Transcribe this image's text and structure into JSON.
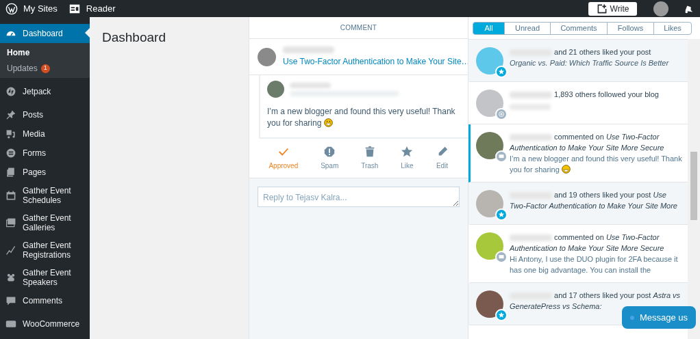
{
  "topbar": {
    "items": [
      {
        "kind": "wp",
        "label": "My Sites"
      },
      {
        "kind": "reader",
        "label": "Reader"
      }
    ],
    "write_button": "Write"
  },
  "sidebar": {
    "items": [
      {
        "label": "Dashboard",
        "selected": true,
        "children": [
          {
            "label": "Home",
            "selected": true
          },
          {
            "label": "Updates",
            "selected": false,
            "badge": "1"
          }
        ]
      },
      {
        "label": "Jetpack",
        "selected": false
      },
      {
        "label": "Posts",
        "selected": false
      },
      {
        "label": "Media",
        "selected": false
      },
      {
        "label": "Forms",
        "selected": false
      },
      {
        "label": "Pages",
        "selected": false
      },
      {
        "label": "Gather Event Schedules",
        "selected": false
      },
      {
        "label": "Gather Event Galleries",
        "selected": false
      },
      {
        "label": "Gather Event Registrations",
        "selected": false
      },
      {
        "label": "Gather Event Speakers",
        "selected": false
      },
      {
        "label": "Comments",
        "selected": false
      },
      {
        "label": "WooCommerce",
        "selected": false
      }
    ]
  },
  "page_title": "Dashboard",
  "comment_panel": {
    "header": "COMMENT",
    "post_link": "Use Two-Factor Authentication to Make Your Site…",
    "comment_text": "I’m a new blogger and found this very useful! Thank you for sharing",
    "actions": [
      {
        "kind": "approve",
        "label": "Approved",
        "on": true
      },
      {
        "kind": "spam",
        "label": "Spam",
        "on": false
      },
      {
        "kind": "trash",
        "label": "Trash",
        "on": false
      },
      {
        "kind": "like",
        "label": "Like",
        "on": false
      },
      {
        "kind": "edit",
        "label": "Edit",
        "on": false
      }
    ],
    "reply_placeholder": "Reply to Tejasv Kalra..."
  },
  "filters": [
    {
      "label": "All",
      "selected": true
    },
    {
      "label": "Unread",
      "selected": false
    },
    {
      "label": "Comments",
      "selected": false
    },
    {
      "label": "Follows",
      "selected": false
    },
    {
      "label": "Likes",
      "selected": false
    }
  ],
  "notifications": [
    {
      "kind": "like",
      "unread": true,
      "selected": false,
      "text": "and 21 others liked your post",
      "subject": "Organic vs. Paid: Which Traffic Source Is Better"
    },
    {
      "kind": "follow",
      "unread": false,
      "selected": false,
      "text": "1,893 others followed your blog"
    },
    {
      "kind": "comment",
      "unread": false,
      "selected": true,
      "text": "commented on *Use Two-Factor Authentication to Make Your Site More Secure*",
      "excerpt": "I’m a new blogger and found this very useful! Thank you for sharing"
    },
    {
      "kind": "like",
      "unread": true,
      "selected": false,
      "text": "and 19 others liked your post *Use Two-Factor Authentication to Make Your Site More*"
    },
    {
      "kind": "comment",
      "unread": false,
      "selected": false,
      "text": "commented on *Use Two-Factor Authentication to Make Your Site More Secure*",
      "excerpt": "Hi Antony, I use the DUO plugin for 2FA because it has one big advantage. You can install the"
    },
    {
      "kind": "like",
      "unread": true,
      "selected": false,
      "text": "and 17 others liked your post *Astra vs GeneratePress vs Schema:*"
    }
  ],
  "chat_button": "Message us"
}
